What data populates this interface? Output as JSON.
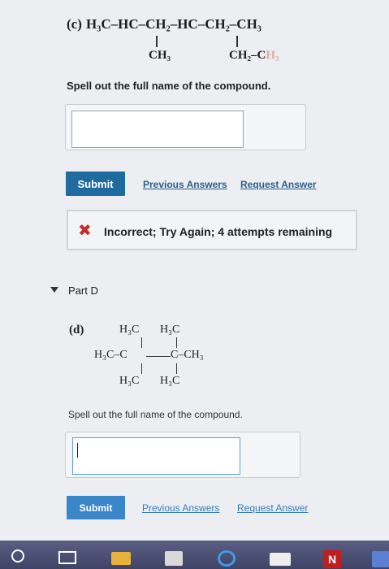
{
  "part_c": {
    "label": "(c)",
    "formula_main": "H₃C–HC–CH₂–HC–CH₂–CH₃",
    "branch_1": "CH₃",
    "branch_2_visible": "CH₂–C",
    "branch_2_faded": "H₃",
    "prompt": "Spell out the full name of the compound.",
    "answer_value": "",
    "submit_label": "Submit",
    "previous_answers_label": "Previous Answers",
    "request_answer_label": "Request Answer",
    "feedback": {
      "icon": "✖",
      "text": "Incorrect; Try Again; 4 attempts remaining",
      "color": "#c42b2b"
    }
  },
  "part_d": {
    "title": "Part D",
    "label": "(d)",
    "top_left": "H₃C",
    "top_right": "H₃C",
    "mid_left": "H₃C–C",
    "mid_right": "C–CH₃",
    "bottom_left": "H₃C",
    "bottom_right": "H₃C",
    "prompt": "Spell out the full name of the compound.",
    "answer_value": "",
    "submit_label": "Submit",
    "previous_answers_label": "Previous Answers",
    "request_answer_label": "Request Answer"
  },
  "taskbar": {
    "n_label": "N",
    "icons": [
      "start-icon",
      "task-view-icon",
      "file-explorer-icon",
      "store-icon",
      "edge-icon",
      "mail-icon",
      "netflix-icon",
      "teams-icon"
    ]
  },
  "colors": {
    "submit_primary": "#1f6b9f",
    "submit_secondary": "#3a86c8",
    "link": "#2b5f8f",
    "error": "#c42b2b"
  }
}
